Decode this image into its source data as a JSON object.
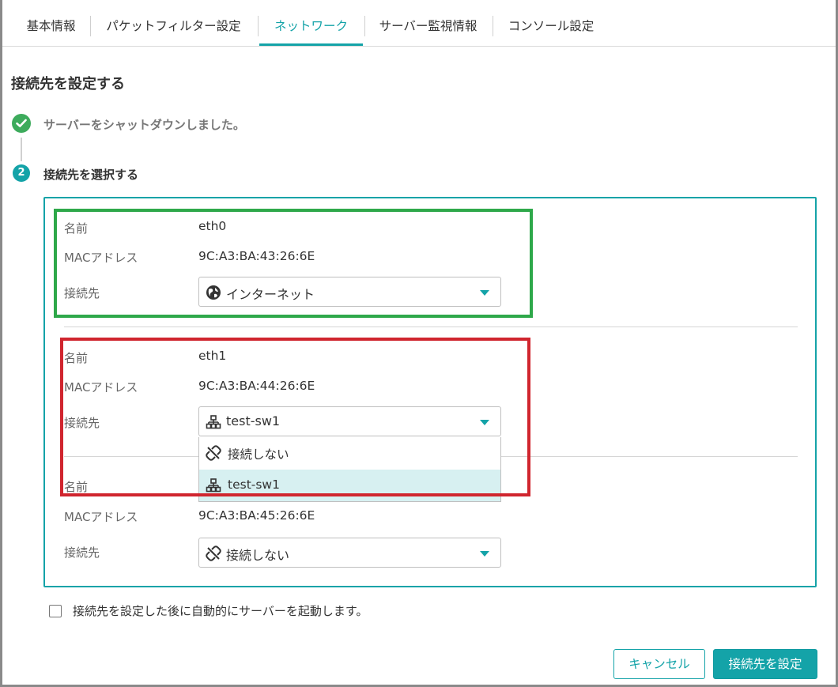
{
  "tabs": [
    {
      "label": "基本情報"
    },
    {
      "label": "パケットフィルター設定"
    },
    {
      "label": "ネットワーク",
      "active": true
    },
    {
      "label": "サーバー監視情報"
    },
    {
      "label": "コンソール設定"
    }
  ],
  "page_title": "接続先を設定する",
  "steps": {
    "done_text": "サーバーをシャットダウンしました。",
    "current_number": "2",
    "current_text": "接続先を選択する"
  },
  "labels": {
    "name": "名前",
    "mac": "MACアドレス",
    "destination": "接続先"
  },
  "interfaces": [
    {
      "name": "eth0",
      "mac": "9C:A3:BA:43:26:6E",
      "destination": "インターネット",
      "destination_icon": "globe-icon"
    },
    {
      "name": "eth1",
      "mac": "9C:A3:BA:44:26:6E",
      "destination": "test-sw1",
      "destination_icon": "switch-icon"
    },
    {
      "name": "",
      "mac": "9C:A3:BA:45:26:6E",
      "destination": "接続しない",
      "destination_icon": "disconnect-icon"
    }
  ],
  "dropdown": {
    "options": [
      {
        "label": "接続しない",
        "icon": "disconnect-icon"
      },
      {
        "label": "test-sw1",
        "icon": "switch-icon",
        "selected": true
      }
    ]
  },
  "auto_start": {
    "label": "接続先を設定した後に自動的にサーバーを起動します。",
    "checked": false
  },
  "buttons": {
    "cancel": "キャンセル",
    "submit": "接続先を設定"
  },
  "colors": {
    "accent": "#14a3a8",
    "success": "#3dab5c",
    "highlight_green": "#2ea84a",
    "highlight_red": "#d0252e"
  }
}
